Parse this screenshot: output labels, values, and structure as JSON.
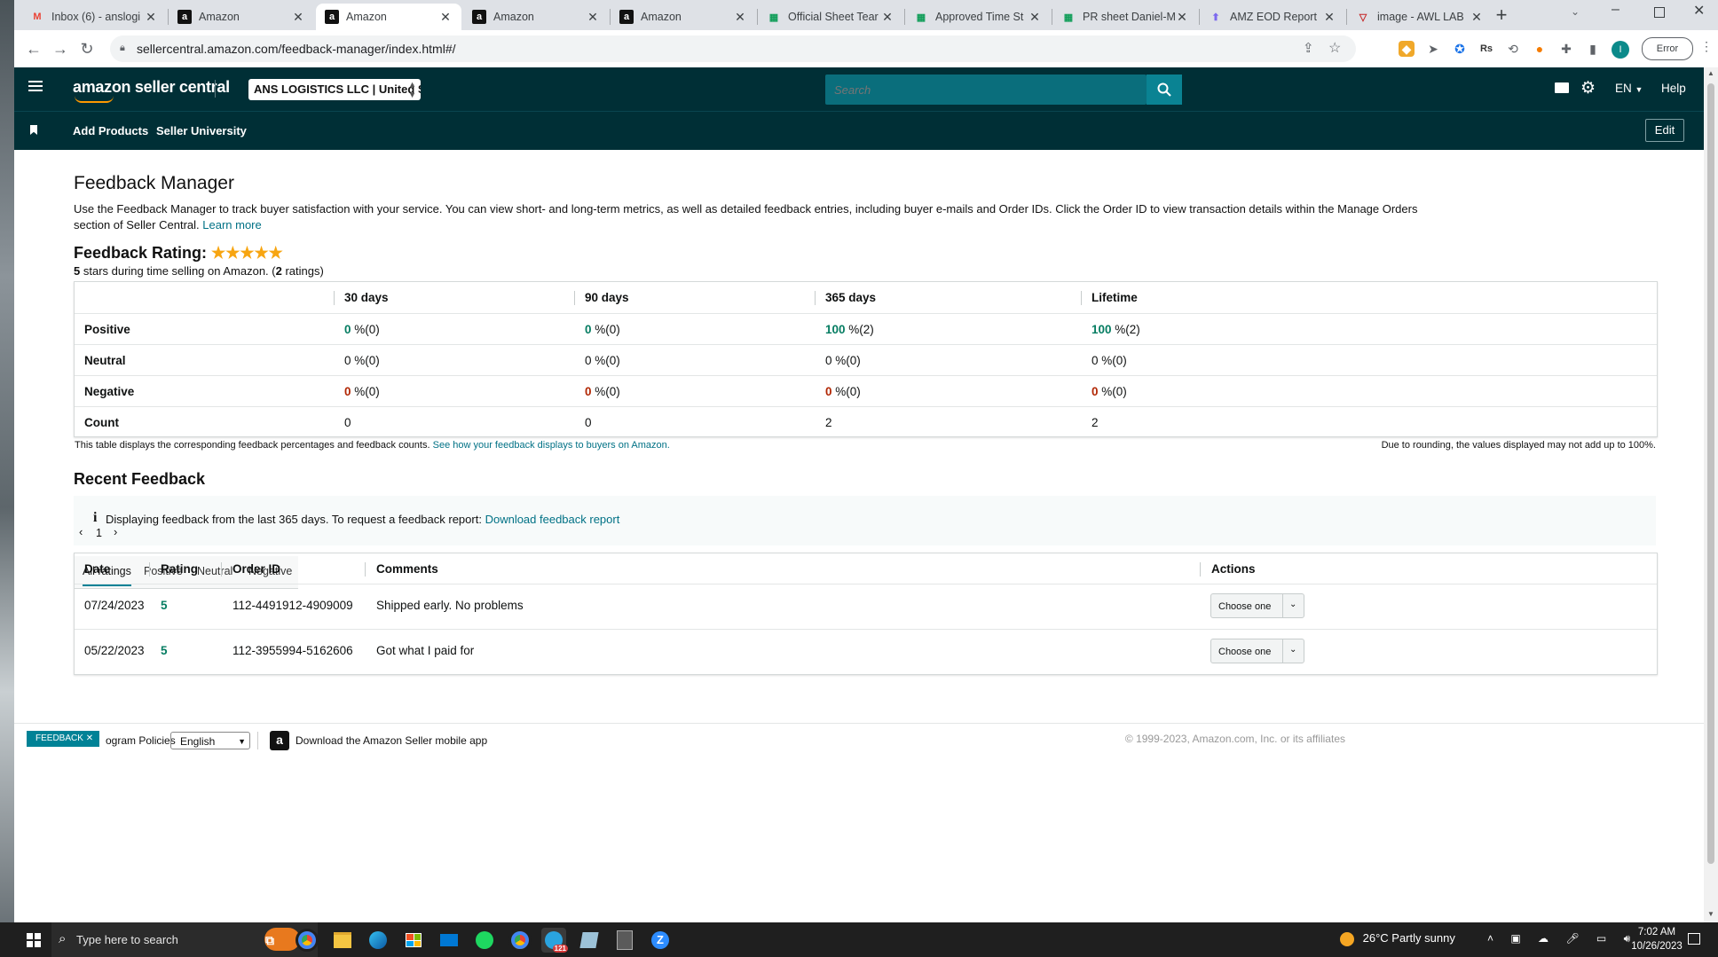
{
  "browser": {
    "tabs": [
      {
        "label": "Inbox (6) - anslogi",
        "icon": "gmail-icon"
      },
      {
        "label": "Amazon",
        "icon": "amazon-icon"
      },
      {
        "label": "Amazon",
        "icon": "amazon-icon"
      },
      {
        "label": "Amazon",
        "icon": "amazon-icon"
      },
      {
        "label": "Amazon",
        "icon": "amazon-icon"
      },
      {
        "label": "Official Sheet Tear",
        "icon": "sheets-icon"
      },
      {
        "label": "Approved Time St",
        "icon": "sheets-icon"
      },
      {
        "label": "PR sheet Daniel-M",
        "icon": "sheets-icon"
      },
      {
        "label": "AMZ EOD Report",
        "icon": "clickup-icon"
      },
      {
        "label": "image - AWL LAB",
        "icon": "awl-icon"
      }
    ],
    "url": "sellercentral.amazon.com/feedback-manager/index.html#/",
    "profile_initial": "I",
    "error_label": "Error"
  },
  "header": {
    "logo_text": "amazon seller central",
    "account": "ANS LOGISTICS LLC | United S...",
    "search_placeholder": "Search",
    "lang": "EN",
    "help": "Help",
    "subnav": [
      "Add Products",
      "Seller University"
    ],
    "edit": "Edit"
  },
  "page": {
    "title": "Feedback Manager",
    "intro_line1": "Use the Feedback Manager to track buyer satisfaction with your service. You can view short- and long-term metrics, as well as detailed feedback entries, including buyer e-mails and Order IDs. Click the Order ID to view transaction details within the Manage Orders",
    "intro_line2": "section of Seller Central.",
    "learn_more": "Learn more",
    "rating_label": "Feedback Rating:",
    "rating_stars": 5,
    "rating_summary_stars": "5",
    "rating_summary_mid": " stars during time selling on Amazon. (",
    "rating_summary_count": "2",
    "rating_summary_end": " ratings)"
  },
  "metrics": {
    "columns": [
      "30 days",
      "90 days",
      "365 days",
      "Lifetime"
    ],
    "rows": [
      {
        "label": "Positive",
        "values": [
          [
            "0",
            " %(0)"
          ],
          [
            "0",
            " %(0)"
          ],
          [
            "100",
            " %(2)"
          ],
          [
            "100",
            " %(2)"
          ]
        ]
      },
      {
        "label": "Neutral",
        "values": [
          [
            "0",
            " %(0)"
          ],
          [
            "0",
            " %(0)"
          ],
          [
            "0",
            " %(0)"
          ],
          [
            "0",
            " %(0)"
          ]
        ]
      },
      {
        "label": "Negative",
        "values": [
          [
            "0",
            " %(0)"
          ],
          [
            "0",
            " %(0)"
          ],
          [
            "0",
            " %(0)"
          ],
          [
            "0",
            " %(0)"
          ]
        ]
      },
      {
        "label": "Count",
        "values": [
          [
            "0",
            ""
          ],
          [
            "0",
            ""
          ],
          [
            "2",
            ""
          ],
          [
            "2",
            ""
          ]
        ]
      }
    ],
    "footnote": "This table displays the corresponding feedback percentages and feedback counts.",
    "footnote_link": "See how your feedback displays to buyers on Amazon.",
    "rounding_note": "Due to rounding, the values displayed may not add up to 100%."
  },
  "recent": {
    "title": "Recent Feedback",
    "info": "Displaying feedback from the last 365 days. To request a feedback report:",
    "info_link": "Download feedback report",
    "tabs": [
      "All ratings",
      "Positive",
      "Neutral",
      "Negative"
    ],
    "page": "1",
    "columns": [
      "Date",
      "Rating",
      "Order ID",
      "Comments",
      "Actions"
    ],
    "rows": [
      {
        "date": "07/24/2023",
        "rating": "5",
        "order_id": "112-4491912-4909009",
        "comment": "Shipped early. No problems",
        "action": "Choose one"
      },
      {
        "date": "05/22/2023",
        "rating": "5",
        "order_id": "112-3955994-5162606",
        "comment": "Got what I paid for",
        "action": "Choose one"
      }
    ]
  },
  "footer": {
    "feedback_tab": "FEEDBACK",
    "program_policies": "ogram Policies",
    "language": "English",
    "mobile_app": "Download the Amazon Seller mobile app",
    "copyright": "© 1999-2023, Amazon.com, Inc. or its affiliates"
  },
  "taskbar": {
    "search": "Type here to search",
    "weather": "26°C  Partly sunny",
    "time": "7:02 AM",
    "date": "10/26/2023",
    "telegram_badge": "121",
    "weather_badge": "1"
  },
  "colors": {
    "header_bg": "#002f36",
    "search_bg": "#0a6e7c",
    "link": "#007185",
    "positive": "#067d62",
    "negative": "#b12704",
    "star": "#f7a511"
  }
}
